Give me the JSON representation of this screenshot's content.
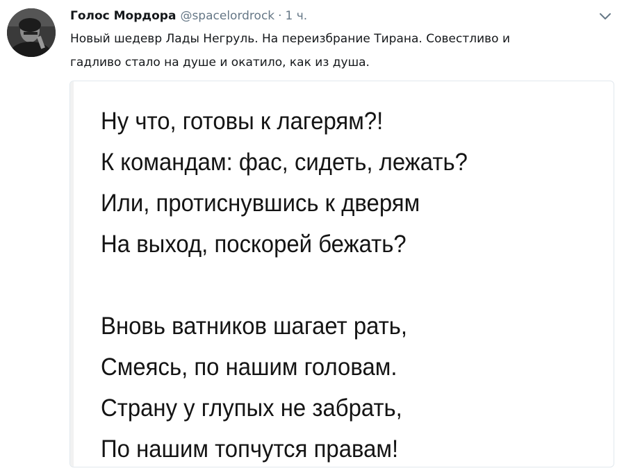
{
  "tweet": {
    "author_name": "Голос Мордора",
    "author_handle": "@spacelordrock",
    "separator": "·",
    "timestamp": "1 ч.",
    "text_lines": [
      "Новый шедевр Лады Негруль. На переизбрание Тирана. Совестливо и",
      "гадливо стало на душе и окатило, как из душа."
    ],
    "avatar_icon": "user-avatar-photo",
    "menu_icon": "chevron-down-icon"
  },
  "media": {
    "poem_stanza_1": [
      "Ну что, готовы к лагерям?!",
      "К командам: фас, сидеть, лежать?",
      "Или, протиснувшись к дверям",
      "На выход, поскорей бежать?"
    ],
    "poem_stanza_2": [
      "Вновь ватников шагает рать,",
      "Смеясь, по нашим головам.",
      "Страну у глупых не забрать,",
      "По нашим топчутся правам!"
    ]
  },
  "colors": {
    "text_primary": "#14171a",
    "text_secondary": "#657786",
    "border": "#e1e8ed"
  }
}
